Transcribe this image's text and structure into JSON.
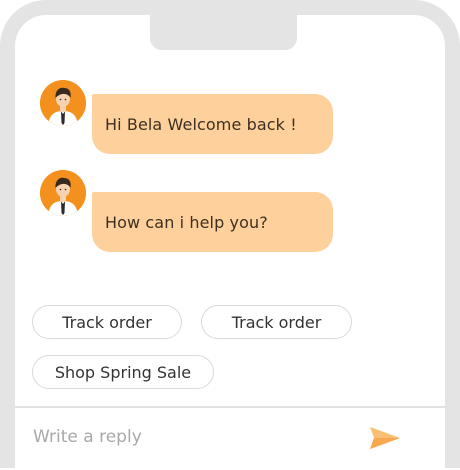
{
  "chat": {
    "messages": [
      {
        "text": "Hi Bela Welcome back !"
      },
      {
        "text": "How can i help you?"
      }
    ],
    "quick_replies": [
      {
        "label": "Track order"
      },
      {
        "label": "Track order"
      },
      {
        "label": "Shop Spring Sale"
      }
    ]
  },
  "composer": {
    "placeholder": "Write a reply",
    "send_icon": "paper-plane-icon"
  },
  "colors": {
    "bubble": "#fed19c",
    "avatar": "#f4901e",
    "send_icon": "#fbbf74",
    "frame": "#e4e4e4"
  }
}
